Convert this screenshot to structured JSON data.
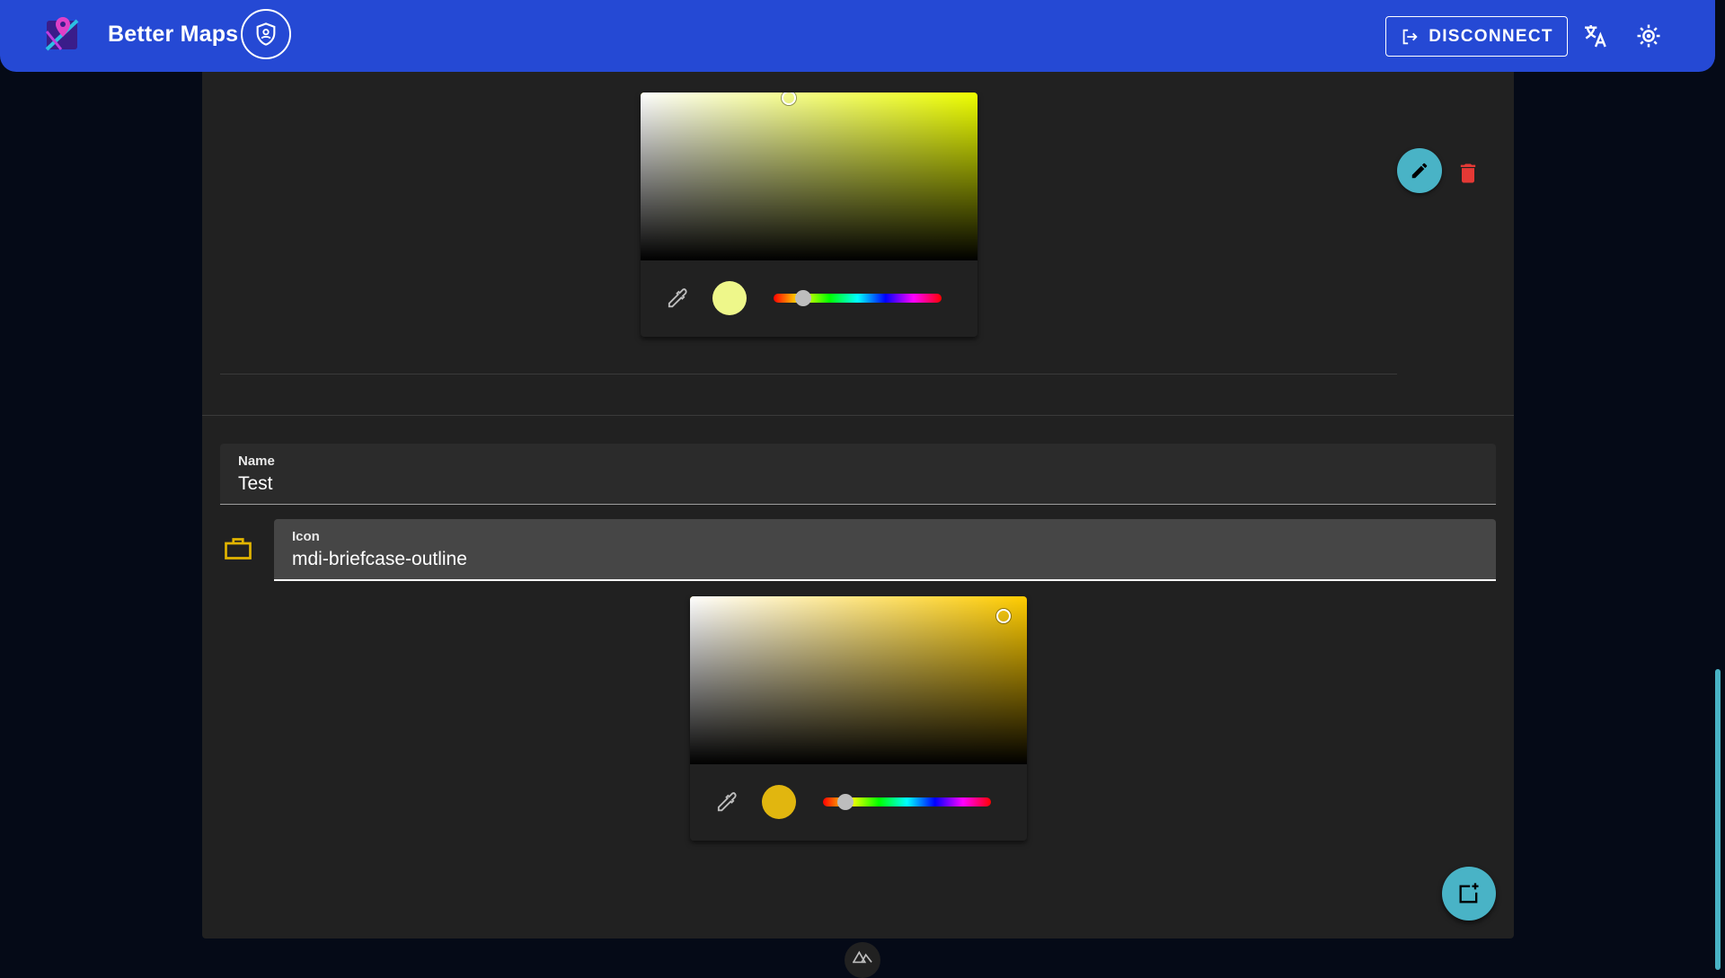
{
  "header": {
    "title": "Better Maps",
    "disconnect_label": "DISCONNECT",
    "icons": [
      "app-logo-icon",
      "shield-account-icon",
      "logout-icon",
      "translate-icon",
      "brightness-icon"
    ]
  },
  "colors": {
    "appbar": "#2549d4",
    "accent": "#49b3c6",
    "delete": "#e53935",
    "card": "#212121",
    "background": "#050a17"
  },
  "top_picker": {
    "hue": 64,
    "swatch_color": "#eef78a",
    "saturation": 0.44,
    "value": 0.97
  },
  "form": {
    "name_label": "Name",
    "name_value": "Test",
    "icon_label": "Icon",
    "icon_value": "mdi-briefcase-outline",
    "icon_color": "#e1b400"
  },
  "bottom_picker": {
    "hue": 48,
    "swatch_color": "#e1b60f",
    "saturation": 0.93,
    "value": 0.88
  },
  "actions": {
    "edit_icon": "pencil-icon",
    "delete_icon": "trash-icon",
    "add_icon": "tab-plus-icon"
  }
}
